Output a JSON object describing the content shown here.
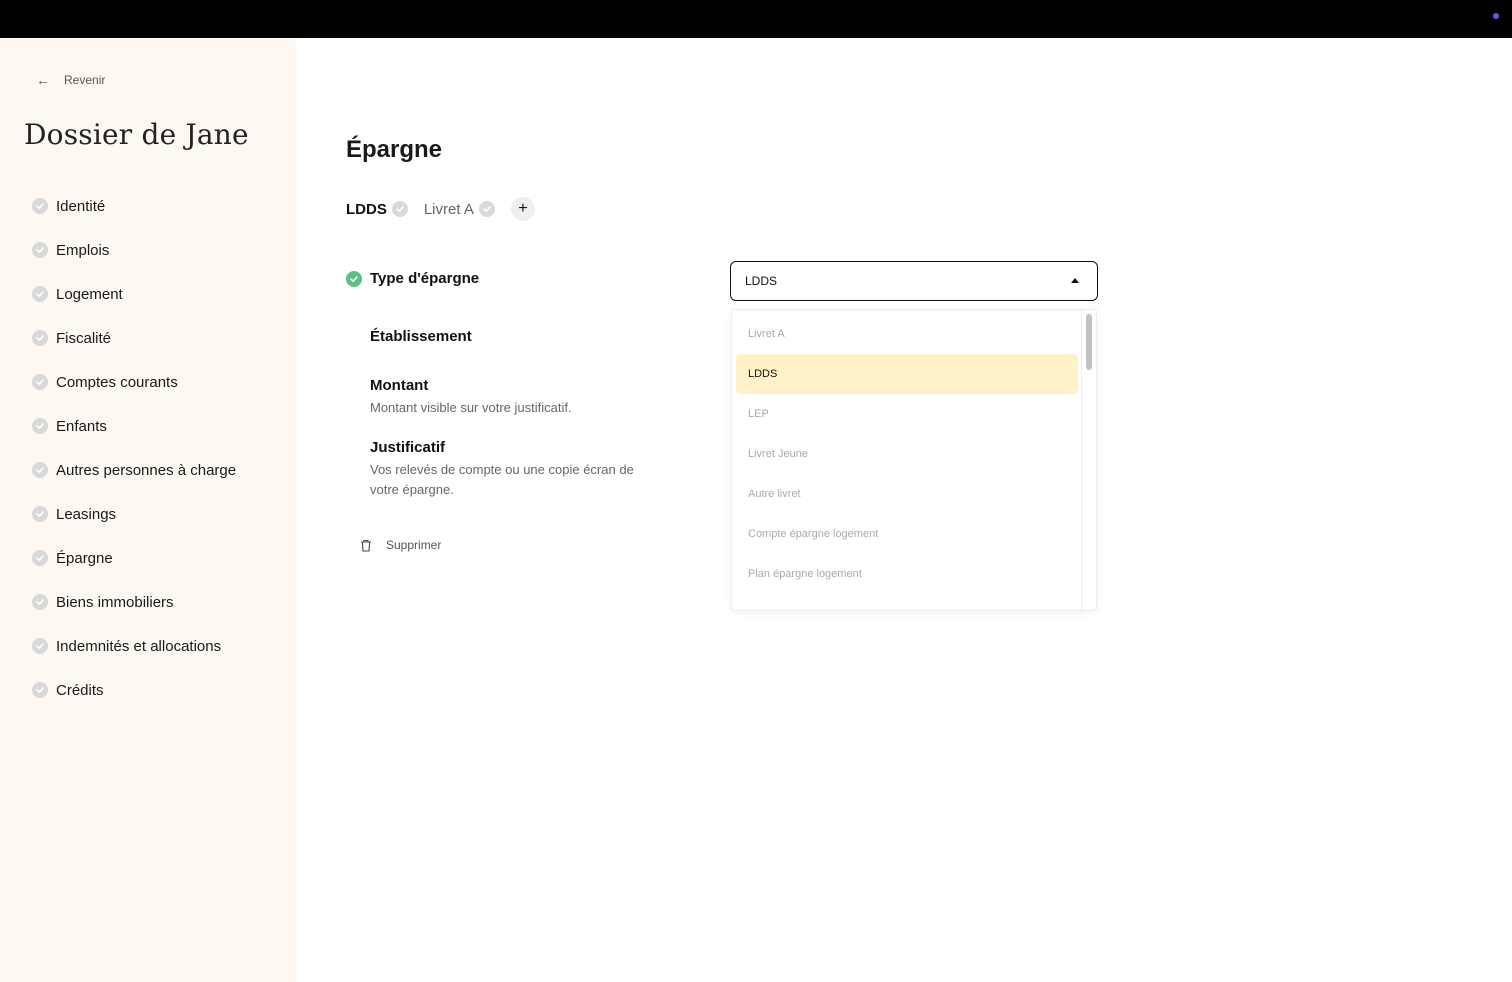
{
  "sidebar": {
    "back_label": "Revenir",
    "title": "Dossier de Jane",
    "items": [
      {
        "label": "Identité"
      },
      {
        "label": "Emplois"
      },
      {
        "label": "Logement"
      },
      {
        "label": "Fiscalité"
      },
      {
        "label": "Comptes courants"
      },
      {
        "label": "Enfants"
      },
      {
        "label": "Autres personnes à charge"
      },
      {
        "label": "Leasings"
      },
      {
        "label": "Épargne"
      },
      {
        "label": "Biens immobiliers"
      },
      {
        "label": "Indemnités et allocations"
      },
      {
        "label": "Crédits"
      }
    ]
  },
  "main": {
    "title": "Épargne",
    "tabs": [
      {
        "label": "LDDS",
        "active": true
      },
      {
        "label": "Livret A",
        "active": false
      }
    ],
    "add_label": "+",
    "fields": {
      "type": {
        "label": "Type d'épargne"
      },
      "etablissement": {
        "label": "Établissement"
      },
      "montant": {
        "label": "Montant",
        "description": "Montant visible sur votre justificatif."
      },
      "justificatif": {
        "label": "Justificatif",
        "description": "Vos relevés de compte ou une copie écran de votre épargne."
      }
    },
    "delete_label": "Supprimer"
  },
  "select": {
    "value": "LDDS",
    "options": [
      {
        "label": "Livret A",
        "selected": false
      },
      {
        "label": "LDDS",
        "selected": true
      },
      {
        "label": "LEP",
        "selected": false
      },
      {
        "label": "Livret Jeune",
        "selected": false
      },
      {
        "label": "Autre livret",
        "selected": false
      },
      {
        "label": "Compte épargne logement",
        "selected": false
      },
      {
        "label": "Plan épargne logement",
        "selected": false
      }
    ]
  },
  "colors": {
    "sidebar_bg": "#fdf8f2",
    "selected_option_bg": "#fff2c8",
    "check_green": "#5cbf85",
    "check_grey": "#d9d9d9"
  }
}
